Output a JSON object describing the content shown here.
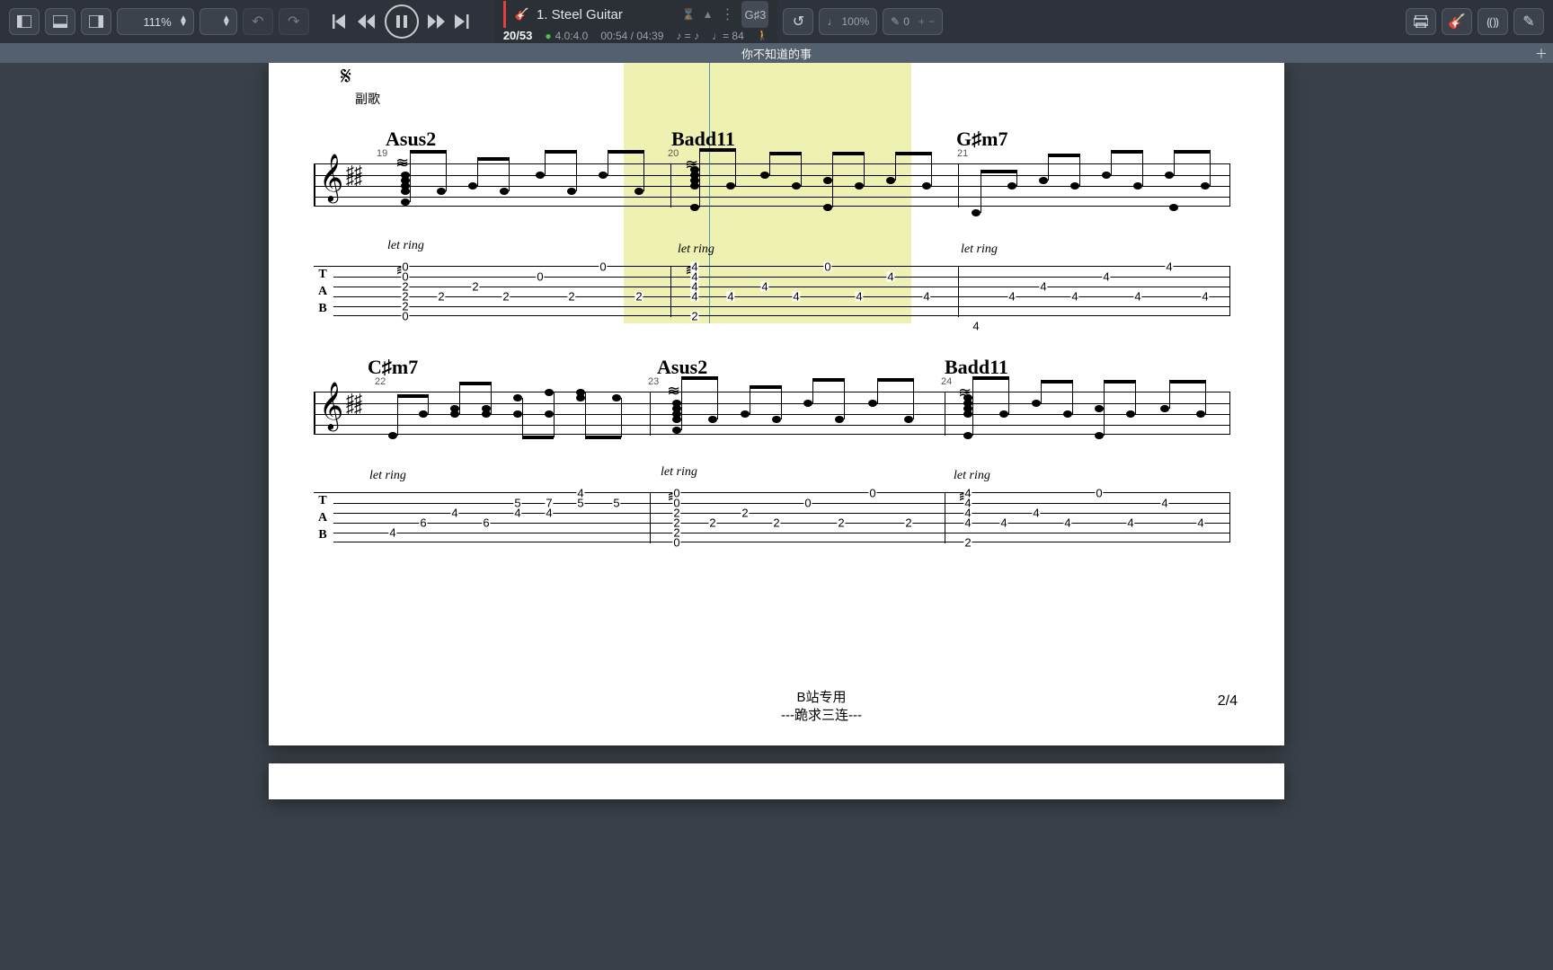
{
  "toolbar": {
    "zoom": "111%",
    "track_name": "1. Steel Guitar",
    "bar_position": "20/53",
    "beat_position": "4.0:4.0",
    "time": "00:54 / 04:39",
    "tempo_prefix": "♪ = ♪",
    "tempo_bpm": "♩= 84",
    "key_label": "G♯3",
    "speed_pct": "100%",
    "tuner_val": "0"
  },
  "song_tab": "你不知道的事",
  "score": {
    "section_label": "副歌",
    "system1": {
      "bars": [
        {
          "no": "19",
          "chord": "Asus2",
          "let_ring": "let ring",
          "tab": [
            [
              "0",
              "0",
              "2",
              "2",
              "2",
              "0"
            ],
            [
              "2"
            ],
            [
              "2"
            ],
            [
              "0"
            ],
            [
              "2"
            ],
            [
              "2"
            ],
            [
              "0"
            ],
            [
              "2"
            ]
          ]
        },
        {
          "no": "20",
          "chord": "Badd11",
          "let_ring": "let ring",
          "tab": [
            [
              "4",
              "4",
              "4",
              "4",
              "2"
            ],
            [
              "4"
            ],
            [
              "4"
            ],
            [
              "4"
            ],
            [
              "0"
            ],
            [
              "4"
            ],
            [
              "4"
            ],
            [
              "4"
            ]
          ]
        },
        {
          "no": "21",
          "chord": "G♯m7",
          "let_ring": "let ring",
          "tab": [
            [
              "4"
            ],
            [
              "4"
            ],
            [
              "4"
            ],
            [
              "4"
            ],
            [
              "4"
            ],
            [
              "4"
            ],
            [
              "4"
            ],
            [
              "4"
            ]
          ]
        }
      ]
    },
    "system2": {
      "bars": [
        {
          "no": "22",
          "chord": "C♯m7",
          "let_ring": "let ring",
          "tab": [
            [
              "4"
            ],
            [
              "4"
            ],
            [
              "6"
            ],
            [
              "6"
            ],
            [
              "5",
              "4"
            ],
            [
              "7",
              "4"
            ],
            [
              "4",
              "5"
            ],
            [
              "5"
            ]
          ]
        },
        {
          "no": "23",
          "chord": "Asus2",
          "let_ring": "let ring",
          "tab": [
            [
              "0",
              "0",
              "2",
              "2",
              "2",
              "0"
            ],
            [
              "2"
            ],
            [
              "2"
            ],
            [
              "0"
            ],
            [
              "2"
            ],
            [
              "2"
            ],
            [
              "0"
            ],
            [
              "2"
            ]
          ]
        },
        {
          "no": "24",
          "chord": "Badd11",
          "let_ring": "let ring",
          "tab": [
            [
              "4",
              "4",
              "4",
              "4",
              "2"
            ],
            [
              "4"
            ],
            [
              "4"
            ],
            [
              "4"
            ],
            [
              "0"
            ],
            [
              "4"
            ],
            [
              "4"
            ],
            [
              "4"
            ]
          ]
        }
      ]
    },
    "footer1": "B站专用",
    "footer2": "---跪求三连---",
    "page_no": "2/4"
  }
}
